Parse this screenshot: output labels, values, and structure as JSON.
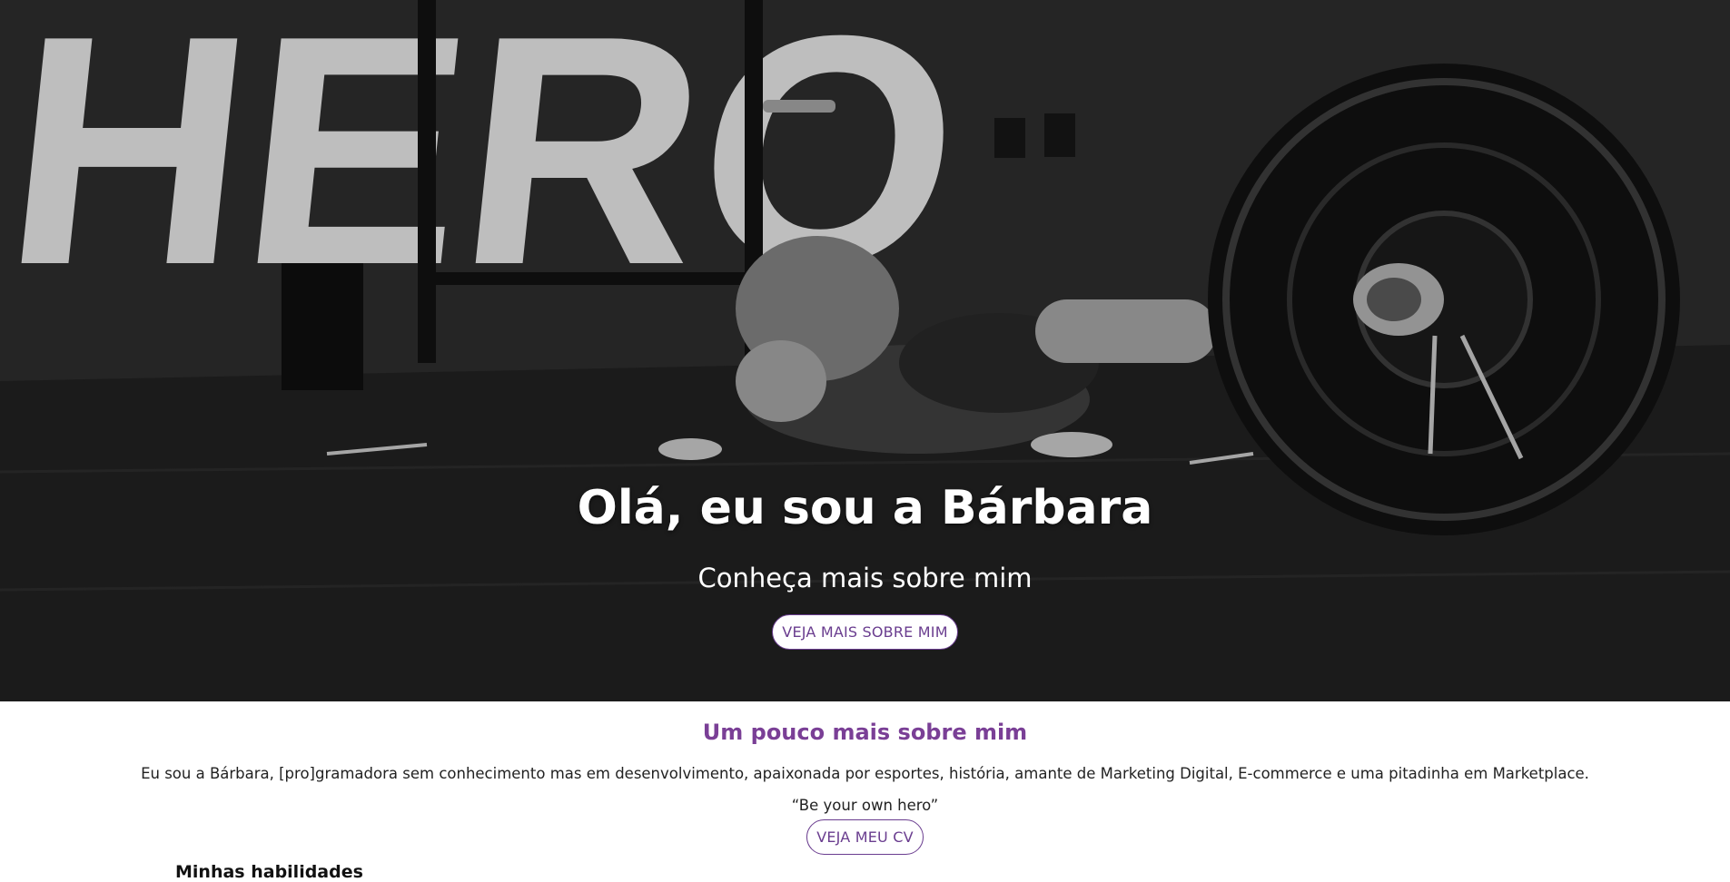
{
  "hero": {
    "title": "Olá, eu sou a Bárbara",
    "subtitle": "Conheça mais sobre mim",
    "button_label": "VEJA MAIS SOBRE MIM",
    "wall_text": "HERO"
  },
  "about": {
    "title": "Um pouco mais sobre mim",
    "text": "Eu sou a Bárbara, [pro]gramadora sem conhecimento mas em desenvolvimento, apaixonada por esportes, história, amante de Marketing Digital, E-commerce e uma pitadinha em Marketplace.",
    "quote": "“Be your own hero”",
    "button_label": "VEJA MEU CV"
  },
  "skills": {
    "title": "Minhas habilidades"
  },
  "colors": {
    "accent": "#7a3f96",
    "button_text": "#6a3d8f"
  }
}
